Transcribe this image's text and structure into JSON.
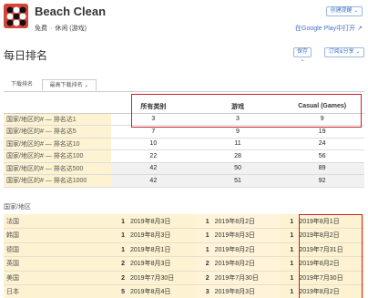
{
  "app": {
    "title": "Beach Clean",
    "price": "免费",
    "category": "休闲 (游戏)",
    "alert_button": "创建提醒 ⌄",
    "google_play_link": "在Google Play中打开 ↗",
    "icon": "go-board-icon"
  },
  "page": {
    "title": "每日排名",
    "save_button": "保存 ⌄",
    "subscribe_button": "订阅&分享 ⌄"
  },
  "tabs": [
    "下载排名",
    "最高下载排名 ⌄"
  ],
  "rank_table": {
    "columns": [
      "所有类别",
      "游戏",
      "Casual (Games)"
    ],
    "rows": [
      {
        "label": "国家/地区的# — 排名达1",
        "values": [
          "3",
          "3",
          "9"
        ]
      },
      {
        "label": "国家/地区的# — 排名达5",
        "values": [
          "7",
          "9",
          "19"
        ]
      },
      {
        "label": "国家/地区的# — 排名达10",
        "values": [
          "10",
          "11",
          "24"
        ]
      },
      {
        "label": "国家/地区的# — 排名达100",
        "values": [
          "22",
          "28",
          "56"
        ]
      },
      {
        "label": "国家/地区的# — 排名达500",
        "values": [
          "42",
          "50",
          "89"
        ]
      },
      {
        "label": "国家/地区的# — 排名达1000",
        "values": [
          "42",
          "51",
          "92"
        ]
      }
    ]
  },
  "country_section": {
    "title": "国家/地区",
    "rows": [
      {
        "country": "法国",
        "cells": [
          {
            "rank": "1",
            "date": "2019年8月3日"
          },
          {
            "rank": "1",
            "date": "2019年8月2日"
          },
          {
            "rank": "1",
            "date": "2019年8月1日"
          }
        ]
      },
      {
        "country": "韩国",
        "cells": [
          {
            "rank": "1",
            "date": "2019年8月3日"
          },
          {
            "rank": "1",
            "date": "2019年8月3日"
          },
          {
            "rank": "1",
            "date": "2019年8月2日"
          }
        ]
      },
      {
        "country": "德国",
        "cells": [
          {
            "rank": "1",
            "date": "2019年8月1日"
          },
          {
            "rank": "1",
            "date": "2019年8月2日"
          },
          {
            "rank": "1",
            "date": "2019年7月31日"
          }
        ]
      },
      {
        "country": "英国",
        "cells": [
          {
            "rank": "2",
            "date": "2019年8月3日"
          },
          {
            "rank": "2",
            "date": "2019年8月2日"
          },
          {
            "rank": "1",
            "date": "2019年8月2日"
          }
        ]
      },
      {
        "country": "美国",
        "cells": [
          {
            "rank": "2",
            "date": "2019年7月30日"
          },
          {
            "rank": "2",
            "date": "2019年7月30日"
          },
          {
            "rank": "1",
            "date": "2019年7月30日"
          }
        ]
      },
      {
        "country": "日本",
        "cells": [
          {
            "rank": "5",
            "date": "2019年8月4日"
          },
          {
            "rank": "3",
            "date": "2019年8月3日"
          },
          {
            "rank": "1",
            "date": "2019年8月2日"
          }
        ]
      }
    ]
  },
  "colors": {
    "highlight": "#c9202b",
    "accent": "#4473c5",
    "row_tint": "#fdf3d2"
  }
}
